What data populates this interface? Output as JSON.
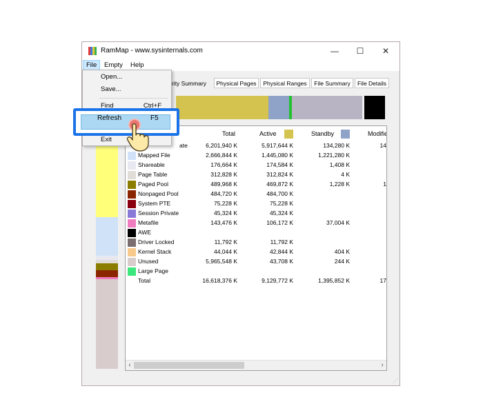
{
  "window": {
    "title": "RamMap - www.sysinternals.com",
    "controls": {
      "minimize": "—",
      "maximize": "☐",
      "close": "✕"
    }
  },
  "menubar": {
    "items": [
      "File",
      "Empty",
      "Help"
    ]
  },
  "file_menu": {
    "items": [
      {
        "label": "Open...",
        "shortcut": ""
      },
      {
        "label": "Save...",
        "shortcut": ""
      },
      {
        "label": "Find",
        "shortcut": "Ctrl+F"
      },
      {
        "label": "Refresh",
        "shortcut": "F5"
      },
      {
        "label": "Exit",
        "shortcut": ""
      }
    ]
  },
  "tabs": [
    "rity Summary",
    "Physical Pages",
    "Physical Ranges",
    "File Summary",
    "File Details"
  ],
  "table": {
    "headers": {
      "total": "Total",
      "active": "Active",
      "standby": "Standby",
      "modified": "Modifie"
    },
    "header_colors": {
      "active": "#d4c44f",
      "standby": "#8fa3c8"
    },
    "rows": [
      {
        "name": "ate",
        "color": "",
        "total": "6,201,940 K",
        "active": "5,917,644 K",
        "standby": "134,280 K",
        "modified": "14"
      },
      {
        "name": "Mapped File",
        "color": "#cfe2f8",
        "total": "2,666,844 K",
        "active": "1,445,080 K",
        "standby": "1,221,280 K",
        "modified": ""
      },
      {
        "name": "Shareable",
        "color": "#e8e8f0",
        "total": "176,664 K",
        "active": "174,584 K",
        "standby": "1,408 K",
        "modified": ""
      },
      {
        "name": "Page Table",
        "color": "#e0dcd8",
        "total": "312,828 K",
        "active": "312,824 K",
        "standby": "4 K",
        "modified": ""
      },
      {
        "name": "Paged Pool",
        "color": "#8b7d00",
        "total": "489,968 K",
        "active": "469,872 K",
        "standby": "1,228 K",
        "modified": "1"
      },
      {
        "name": "Nonpaged Pool",
        "color": "#8b2500",
        "total": "484,720 K",
        "active": "484,700 K",
        "standby": "",
        "modified": ""
      },
      {
        "name": "System PTE",
        "color": "#8b0010",
        "total": "75,228 K",
        "active": "75,228 K",
        "standby": "",
        "modified": ""
      },
      {
        "name": "Session Private",
        "color": "#8a7ad8",
        "total": "45,324 K",
        "active": "45,324 K",
        "standby": "",
        "modified": ""
      },
      {
        "name": "Metafile",
        "color": "#f07cc0",
        "total": "143,476 K",
        "active": "106,172 K",
        "standby": "37,004 K",
        "modified": ""
      },
      {
        "name": "AWE",
        "color": "#000000",
        "total": "",
        "active": "",
        "standby": "",
        "modified": ""
      },
      {
        "name": "Driver Locked",
        "color": "#7a6e6e",
        "total": "11,792 K",
        "active": "11,792 K",
        "standby": "",
        "modified": ""
      },
      {
        "name": "Kernel Stack",
        "color": "#f7c98a",
        "total": "44,044 K",
        "active": "42,844 K",
        "standby": "404 K",
        "modified": ""
      },
      {
        "name": "Unused",
        "color": "#d9cccc",
        "total": "5,965,548 K",
        "active": "43,708 K",
        "standby": "244 K",
        "modified": ""
      },
      {
        "name": "Large Page",
        "color": "#3ce87c",
        "total": "",
        "active": "",
        "standby": "",
        "modified": ""
      },
      {
        "name": "Total",
        "color": "",
        "total": "16,618,376 K",
        "active": "9,129,772 K",
        "standby": "1,395,852 K",
        "modified": "17"
      }
    ]
  },
  "highlight": {
    "label": "Refresh",
    "shortcut": "F5"
  },
  "icons": {
    "scroll_left": "‹",
    "scroll_right": "›",
    "hand": "pointer-hand-icon",
    "grip": "⋰"
  }
}
